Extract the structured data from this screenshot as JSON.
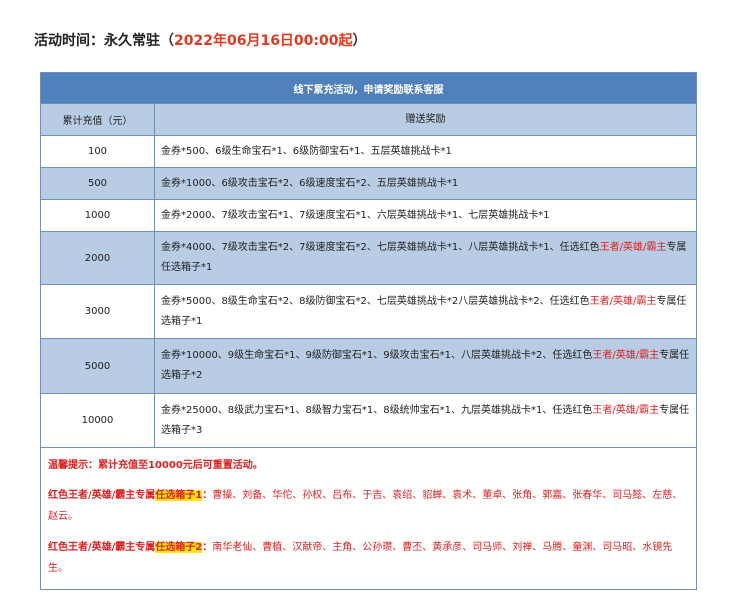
{
  "header": {
    "label": "活动时间：永久常驻",
    "paren_open": "（",
    "date": "2022年06月16日00:00起",
    "paren_close": "）"
  },
  "banner": "线下累充活动，申请奖励联系客服",
  "table": {
    "col1_header": "累计充值（元）",
    "col2_header": "赠送奖励",
    "rows": [
      {
        "amount": "100",
        "reward_pre": "金券*500、6级生命宝石*1、6级防御宝石*1、五层英雄挑战卡*1",
        "reward_red": "",
        "reward_post": ""
      },
      {
        "amount": "500",
        "reward_pre": "金券*1000、6级攻击宝石*2、6级速度宝石*2、五层英雄挑战卡*1",
        "reward_red": "",
        "reward_post": ""
      },
      {
        "amount": "1000",
        "reward_pre": "金券*2000、7级攻击宝石*1、7级速度宝石*1、六层英雄挑战卡*1、七层英雄挑战卡*1",
        "reward_red": "",
        "reward_post": ""
      },
      {
        "amount": "2000",
        "reward_pre": "金券*4000、7级攻击宝石*2、7级速度宝石*2、七层英雄挑战卡*1、八层英雄挑战卡*1、任选红色",
        "reward_red": "王者/英雄/霸主",
        "reward_post": "专属任选箱子*1"
      },
      {
        "amount": "3000",
        "reward_pre": "金券*5000、8级生命宝石*2、8级防御宝石*2、七层英雄挑战卡*2八层英雄挑战卡*2、任选红色",
        "reward_red": "王者/英雄/霸主",
        "reward_post": "专属任选箱子*1"
      },
      {
        "amount": "5000",
        "reward_pre": "金券*10000、9级生命宝石*1、9级防御宝石*1、9级攻击宝石*1、八层英雄挑战卡*2、任选红色",
        "reward_red": "王者/英雄/霸主",
        "reward_post": "专属任选箱子*2"
      },
      {
        "amount": "10000",
        "reward_pre": "金券*25000、8级武力宝石*1、8级智力宝石*1、8级统帅宝石*1、九层英雄挑战卡*1、任选红色",
        "reward_red": "王者/英雄/霸主",
        "reward_post": "专属任选箱子*3"
      }
    ]
  },
  "notes": {
    "tip": "温馨提示：累计充值至10000元后可重置活动。",
    "box1_label": "红色王者/英雄/霸主专属",
    "box1_hl": "任选箱子1",
    "box1_colon": "：",
    "box1_list": "曹操、刘备、华佗、孙权、吕布、于吉、袁绍、貂蝉、袁术、董卓、张角、郭嘉、张春华、司马懿、左慈、赵云。",
    "box2_label": "红色王者/英雄/霸主专属",
    "box2_hl": "任选箱子2",
    "box2_colon": "：",
    "box2_list": "南华老仙、曹植、汉献帝、主角、公孙瓒、曹丕、黄承彦、司马师、刘禅、马腾、童渊、司马昭、水镜先生。"
  },
  "colors": {
    "banner_bg": "#4f81bd",
    "row_blue": "#b8cce4",
    "accent_red": "#e02020",
    "highlight": "#ffe500"
  }
}
